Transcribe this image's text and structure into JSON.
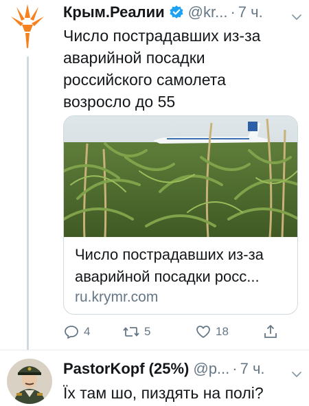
{
  "tweet": {
    "author_name": "Крым.Реалии",
    "handle": "@kr...",
    "separator": "·",
    "time": "7 ч.",
    "text": "Число пострадавших из-за аварийной посадки российского самолета возросло до 55",
    "card": {
      "title": "Число пострадавших из-за аварийной посадки росс...",
      "domain": "ru.krymr.com"
    },
    "actions": {
      "replies": "4",
      "retweets": "5",
      "likes": "18"
    }
  },
  "reply": {
    "author_name": "PastorKopf (25%)",
    "handle": "@p...",
    "separator": "·",
    "time": "7 ч.",
    "text": "Їх там шо, пиздять на полі?"
  },
  "colors": {
    "brand_orange": "#f5821f",
    "verified_blue": "#1da1f2",
    "muted": "#657786",
    "text": "#14171a"
  }
}
